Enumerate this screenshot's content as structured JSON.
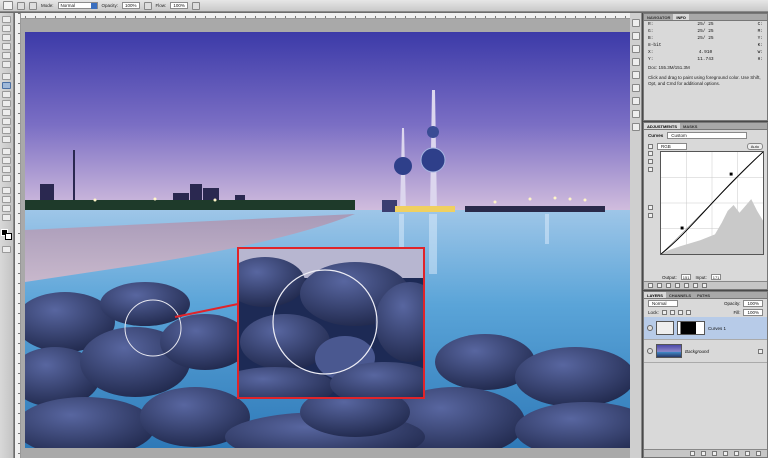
{
  "options_bar": {
    "mode_label": "Mode:",
    "mode_value": "Normal",
    "opacity_label": "Opacity:",
    "opacity_value": "100%",
    "flow_label": "Flow:",
    "flow_value": "100%"
  },
  "info_panel": {
    "tabs": [
      "Navigator",
      "Info"
    ],
    "rows": [
      {
        "left": "R:",
        "mid": "25/ 25",
        "right": "C:"
      },
      {
        "left": "G:",
        "mid": "25/ 25",
        "right": "M:"
      },
      {
        "left": "B:",
        "mid": "25/ 25",
        "right": "Y:"
      },
      {
        "left": "8-bit",
        "mid": "",
        "right": "K:"
      },
      {
        "left": "X:",
        "mid": "4.910",
        "right": "W:"
      },
      {
        "left": "Y:",
        "mid": "11.743",
        "right": "H:"
      }
    ],
    "doc_size": "Doc: 155.3M/151.3M",
    "hint": "Click and drag to paint using foreground color. Use Shift, Opt, and Cmd for additional options."
  },
  "adjustments_panel": {
    "tabs": [
      "Adjustments",
      "Masks"
    ],
    "preset_label": "Curves",
    "preset_value": "Custom",
    "channel_value": "RGB",
    "auto_label": "Auto",
    "output_label": "Output:",
    "output_value": "151",
    "input_label": "Input:",
    "input_value": "171"
  },
  "layers_panel": {
    "tabs": [
      "Layers",
      "Channels",
      "Paths"
    ],
    "blend_value": "Normal",
    "opacity_label": "Opacity:",
    "opacity_value": "100%",
    "lock_label": "Lock:",
    "fill_label": "Fill:",
    "fill_value": "100%",
    "layers": [
      {
        "name": "Curves 1",
        "active": true
      },
      {
        "name": "Background",
        "active": false
      }
    ]
  },
  "colors": {
    "sky_top": "#3b3da8",
    "sky_horizon": "#c9b8dc",
    "water": "#5aa7d8",
    "selection_border": "#e0242a"
  }
}
